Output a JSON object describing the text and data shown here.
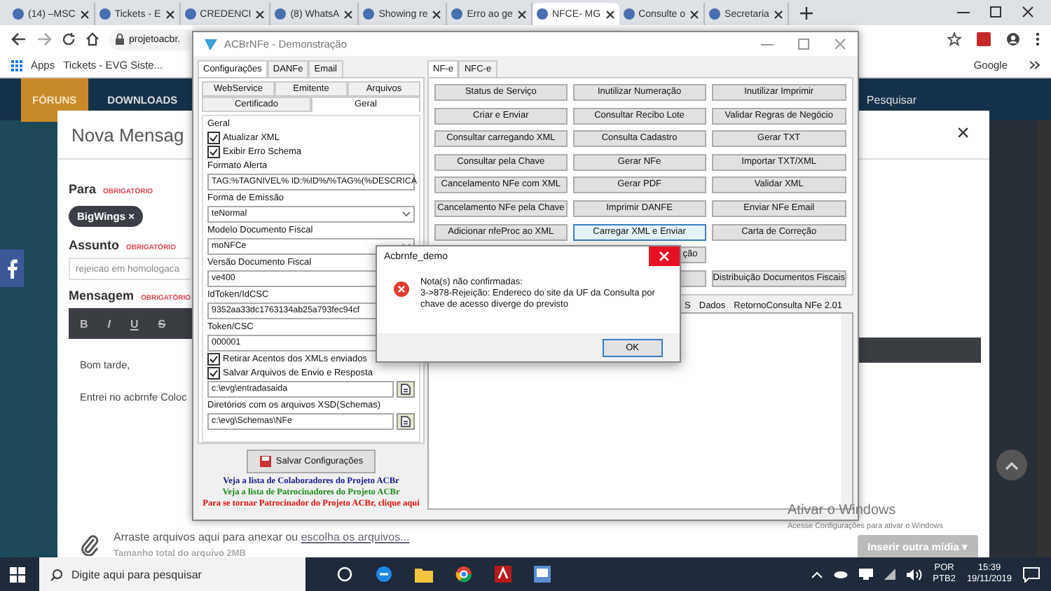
{
  "browser": {
    "tabs": [
      {
        "title": "(14) –MSC",
        "selected": false
      },
      {
        "title": "Tickets - E",
        "selected": false
      },
      {
        "title": "CREDENCI",
        "selected": false
      },
      {
        "title": "(8) WhatsA",
        "selected": false
      },
      {
        "title": "Showing re",
        "selected": false
      },
      {
        "title": "Erro ao ge",
        "selected": false
      },
      {
        "title": "NFCE- MG",
        "selected": true
      },
      {
        "title": "Consulte o",
        "selected": false
      },
      {
        "title": "Secretaria",
        "selected": false
      }
    ],
    "address": "projetoacbr.",
    "bookmarks_left": [
      "Apps",
      "Tickets - EVG Siste..."
    ],
    "bookmarks_right": [
      "Google"
    ]
  },
  "site_nav": {
    "items": [
      "FÓRUNS",
      "DOWNLOADS"
    ],
    "search": "Pesquisar"
  },
  "message_form": {
    "title": "Nova Mensag",
    "to_label": "Para",
    "to_required": "OBRIGATÓRIO",
    "recipient": "BigWings ×",
    "subject_label": "Assunto",
    "subject_required": "OBRIGATÓRIO",
    "subject": "rejeicao em homologaca",
    "message_label": "Mensagem",
    "message_required": "OBRIGATÓRIO",
    "format_buttons": [
      "B",
      "I",
      "U",
      "S"
    ],
    "body": [
      "Bom tarde,",
      "Entrei no acbrnfe Coloc"
    ],
    "attach_text": "Arraste arquivos aqui para anexar ou",
    "attach_link": "escolha os arquivos...",
    "size_note": "Tamanho total do arquivo 2MB",
    "insert_button": "Inserir outra mídia ▾",
    "close": "×"
  },
  "acbr_window": {
    "title": "ACBrNFe - Demonstração",
    "tabs": [
      {
        "label": "Configurações",
        "selected": true
      },
      {
        "label": "DANFe",
        "selected": false
      },
      {
        "label": "Email",
        "selected": false
      }
    ],
    "subtabs_top": [
      {
        "label": "WebService",
        "selected": false
      },
      {
        "label": "Emitente",
        "selected": false
      },
      {
        "label": "Arquivos",
        "selected": false
      }
    ],
    "subtabs_bottom": [
      {
        "label": "Certificado",
        "selected": false
      },
      {
        "label": "Geral",
        "selected": true
      }
    ],
    "group_title": "Geral",
    "fields": [
      {
        "kind": "check",
        "label": "Atualizar XML",
        "checked": true
      },
      {
        "kind": "check",
        "label": "Exibir Erro Schema",
        "checked": true
      },
      {
        "kind": "text",
        "label": "Formato Alerta",
        "value": "TAG:%TAGNIVEL% ID:%ID%/%TAG%(%DESCRICA"
      },
      {
        "kind": "select",
        "label": "Forma de Emissão",
        "value": "teNormal"
      },
      {
        "kind": "select",
        "label": "Modelo Documento Fiscal",
        "value": "moNFCe"
      },
      {
        "kind": "text",
        "label": "Versão Documento Fiscal",
        "value": "ve400"
      },
      {
        "kind": "text",
        "label": "IdToken/IdCSC",
        "value": "9352aa33dc1763134ab25a793fec94cf"
      },
      {
        "kind": "text",
        "label": "Token/CSC",
        "value": "000001"
      },
      {
        "kind": "check",
        "label": "Retirar Acentos dos XMLs enviados",
        "checked": true
      },
      {
        "kind": "check",
        "label": "Salvar Arquivos de Envio e Resposta",
        "checked": true
      },
      {
        "kind": "path",
        "value": "c:\\evg\\entradasaida"
      },
      {
        "kind": "path",
        "label": "Diretórios com os arquivos XSD(Schemas)",
        "value": "c:\\evg\\Schemas\\NFe"
      }
    ],
    "save_button": "Salvar Configurações",
    "links": [
      {
        "text": "Veja a lista de Colaboradores do Projeto ACBr",
        "color": "#1a1a8c"
      },
      {
        "text": "Veja a lista de Patrocinadores do Projeto ACBr",
        "color": "#1e8a1e"
      },
      {
        "text": "Para se tornar Patrocinador do Projeto ACBr, clique aqui",
        "color": "#e01010"
      }
    ],
    "right_tabs": [
      {
        "label": "NF-e",
        "selected": true
      },
      {
        "label": "NFC-e",
        "selected": false
      }
    ],
    "actions": [
      {
        "kind": "button",
        "label": "Status de Serviço"
      },
      {
        "kind": "button",
        "label": "Inutilizar Numeração"
      },
      {
        "kind": "button",
        "label": "Inutilizar Imprimir"
      },
      {
        "kind": "button",
        "label": "Criar e Enviar"
      },
      {
        "kind": "button",
        "label": "Consultar Recibo Lote"
      },
      {
        "kind": "button",
        "label": "Validar Regras de Negócio"
      },
      {
        "kind": "button",
        "label": "Consultar carregando XML"
      },
      {
        "kind": "button",
        "label": "Consulta Cadastro"
      },
      {
        "kind": "button",
        "label": "Gerar TXT"
      },
      {
        "kind": "button",
        "label": "Consultar pela Chave"
      },
      {
        "kind": "button",
        "label": "Gerar NFe"
      },
      {
        "kind": "button",
        "label": "Importar TXT/XML"
      },
      {
        "kind": "button",
        "label": "Cancelamento NFe com XML"
      },
      {
        "kind": "button",
        "label": "Gerar PDF"
      },
      {
        "kind": "button",
        "label": "Validar XML"
      },
      {
        "kind": "button",
        "label": "Cancelamento NFe pela Chave"
      },
      {
        "kind": "button",
        "label": "Imprimir DANFE"
      },
      {
        "kind": "button",
        "label": "Enviar NFe Email"
      },
      {
        "kind": "button",
        "label": "Adicionar nfeProc ao XML"
      },
      {
        "kind": "focused",
        "label": "Carregar XML e Enviar"
      },
      {
        "kind": "button",
        "label": "Carta de Correção"
      },
      {
        "kind": "blank"
      },
      {
        "kind": "partial",
        "label": "ção"
      },
      {
        "kind": "blank"
      },
      {
        "kind": "blank"
      },
      {
        "kind": "hidden"
      },
      {
        "kind": "button",
        "label": "Distribuição Documentos Fiscais"
      }
    ],
    "result_tabs": [
      "S",
      "Dados",
      "RetornoConsulta NFe 2.01"
    ]
  },
  "error_dialog": {
    "title": "Acbrnfe_demo",
    "message": "Nota(s) não confirmadas:\n3->878-Rejeição: Endereco do site da UF da Consulta por chave de acesso diverge do previsto",
    "button": "OK"
  },
  "activation_notice": [
    "Ativar o Windows",
    "Acesse Configurações para ativar o Windows"
  ],
  "taskbar": {
    "search_placeholder": "Digite aqui para pesquisar",
    "language": "POR",
    "layout": "PTB2",
    "time": "15:39",
    "date": "19/11/2019"
  }
}
